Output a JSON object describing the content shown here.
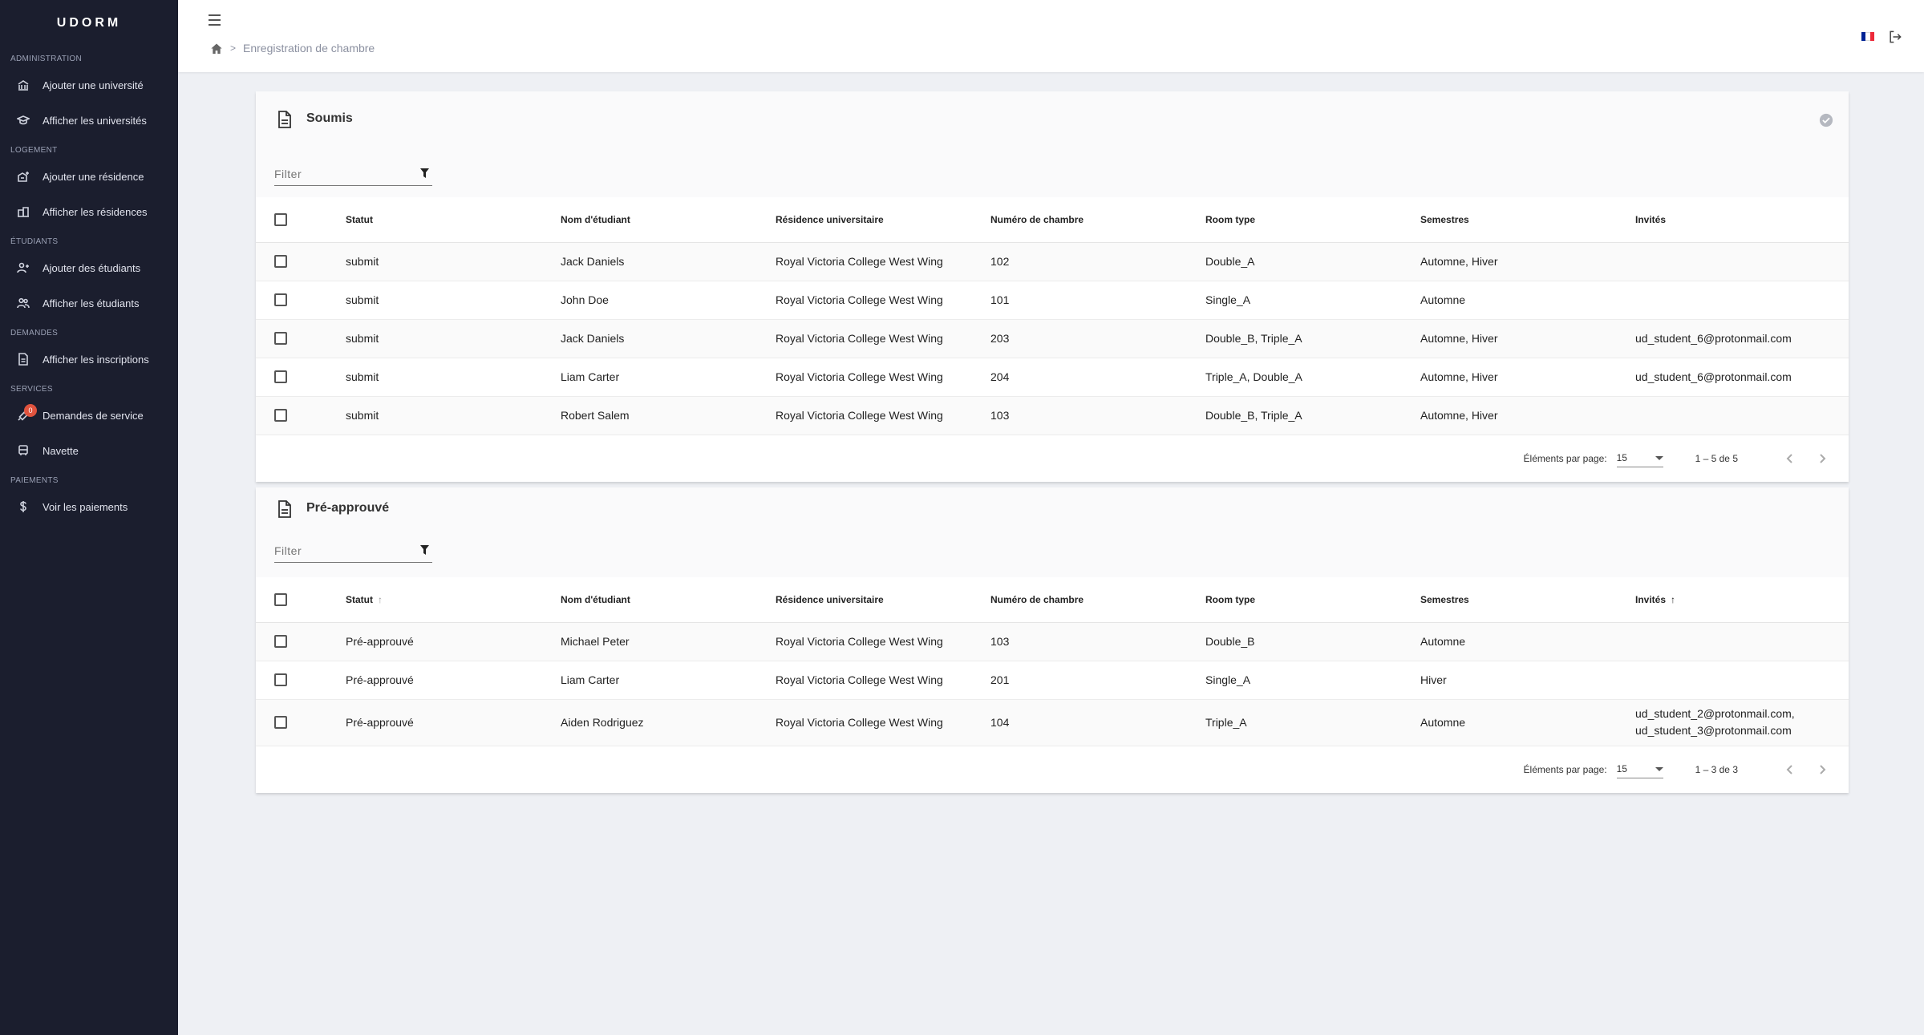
{
  "sidebar": {
    "brand": "UDORM",
    "sections": [
      {
        "title": "ADMINISTRATION",
        "items": [
          {
            "label": "Ajouter une université",
            "icon": "bank-icon"
          },
          {
            "label": "Afficher les universités",
            "icon": "graduation-cap-icon"
          }
        ]
      },
      {
        "title": "LOGEMENT",
        "items": [
          {
            "label": "Ajouter une résidence",
            "icon": "add-building-icon"
          },
          {
            "label": "Afficher les résidences",
            "icon": "buildings-icon"
          }
        ]
      },
      {
        "title": "ÉTUDIANTS",
        "items": [
          {
            "label": "Ajouter des étudiants",
            "icon": "add-user-icon"
          },
          {
            "label": "Afficher les étudiants",
            "icon": "users-icon"
          }
        ]
      },
      {
        "title": "DEMANDES",
        "items": [
          {
            "label": "Afficher les inscriptions",
            "icon": "document-icon"
          }
        ]
      },
      {
        "title": "SERVICES",
        "items": [
          {
            "label": "Demandes de service",
            "icon": "wrench-icon",
            "badge": "0"
          },
          {
            "label": "Navette",
            "icon": "bus-icon"
          }
        ]
      },
      {
        "title": "PAIEMENTS",
        "items": [
          {
            "label": "Voir les paiements",
            "icon": "dollar-icon"
          }
        ]
      }
    ]
  },
  "header": {
    "breadcrumb_current": "Enregistration de chambre",
    "breadcrumb_sep": ">"
  },
  "colors": {
    "sidebar_bg": "#1b1e2e",
    "badge": "#e0533e",
    "flag": [
      "#002395",
      "#ffffff",
      "#ed2939"
    ]
  },
  "columns": [
    "Statut",
    "Nom d'étudiant",
    "Résidence universitaire",
    "Numéro de chambre",
    "Room type",
    "Semestres",
    "Invités"
  ],
  "submitted": {
    "title": "Soumis",
    "filter_placeholder": "Filter",
    "rows": [
      [
        "submit",
        "Jack Daniels",
        "Royal Victoria College West Wing",
        "102",
        "Double_A",
        "Automne, Hiver",
        ""
      ],
      [
        "submit",
        "John Doe",
        "Royal Victoria College West Wing",
        "101",
        "Single_A",
        "Automne",
        ""
      ],
      [
        "submit",
        "Jack Daniels",
        "Royal Victoria College West Wing",
        "203",
        "Double_B, Triple_A",
        "Automne, Hiver",
        "ud_student_6@protonmail.com"
      ],
      [
        "submit",
        "Liam Carter",
        "Royal Victoria College West Wing",
        "204",
        "Triple_A, Double_A",
        "Automne, Hiver",
        "ud_student_6@protonmail.com"
      ],
      [
        "submit",
        "Robert Salem",
        "Royal Victoria College West Wing",
        "103",
        "Double_B, Triple_A",
        "Automne, Hiver",
        ""
      ]
    ],
    "paginator": {
      "label": "Éléments par page:",
      "page_size": "15",
      "range": "1 – 5 de 5"
    }
  },
  "preapproved": {
    "title": "Pré-approuvé",
    "filter_placeholder": "Filter",
    "rows": [
      [
        "Pré-approuvé",
        "Michael Peter",
        "Royal Victoria College West Wing",
        "103",
        "Double_B",
        "Automne",
        ""
      ],
      [
        "Pré-approuvé",
        "Liam Carter",
        "Royal Victoria College West Wing",
        "201",
        "Single_A",
        "Hiver",
        ""
      ],
      [
        "Pré-approuvé",
        "Aiden Rodriguez",
        "Royal Victoria College West Wing",
        "104",
        "Triple_A",
        "Automne",
        "ud_student_2@protonmail.com,\nud_student_3@protonmail.com"
      ]
    ],
    "paginator": {
      "label": "Éléments par page:",
      "page_size": "15",
      "range": "1 – 3 de 3"
    }
  }
}
